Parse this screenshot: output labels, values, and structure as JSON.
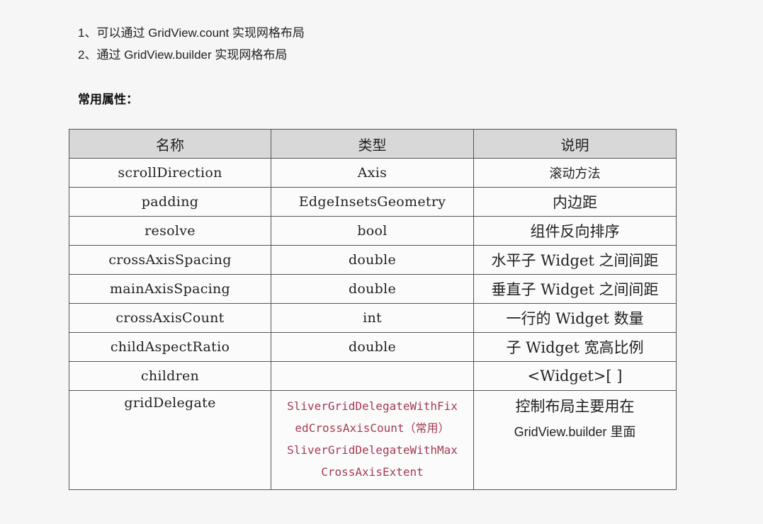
{
  "intro": {
    "line1": "1、可以通过 GridView.count  实现网格布局",
    "line2": "2、通过 GridView.builder 实现网格布局"
  },
  "section_heading": "常用属性：",
  "table": {
    "headers": [
      "名称",
      "类型",
      "说明"
    ],
    "rows": [
      {
        "name": "scrollDirection",
        "type": "Axis",
        "desc": "滚动方法"
      },
      {
        "name": "padding",
        "type": "EdgeInsetsGeometry",
        "desc": "内边距"
      },
      {
        "name": "resolve",
        "type": "bool",
        "desc": "组件反向排序"
      },
      {
        "name": "crossAxisSpacing",
        "type": "double",
        "desc": "水平子 Widget 之间间距"
      },
      {
        "name": "mainAxisSpacing",
        "type": "double",
        "desc": "垂直子 Widget 之间间距"
      },
      {
        "name": "crossAxisCount",
        "type": "int",
        "desc": "一行的 Widget 数量"
      },
      {
        "name": "childAspectRatio",
        "type": "double",
        "desc": "子 Widget 宽高比例"
      },
      {
        "name": "children",
        "type": "",
        "desc": "<Widget>[ ]"
      },
      {
        "name": "gridDelegate",
        "type_lines": [
          "SliverGridDelegateWithFix",
          "edCrossAxisCount（常用）",
          "SliverGridDelegateWithMax",
          "CrossAxisExtent"
        ],
        "desc_line1": "控制布局主要用在",
        "desc_line2": "GridView.builder 里面"
      }
    ]
  }
}
